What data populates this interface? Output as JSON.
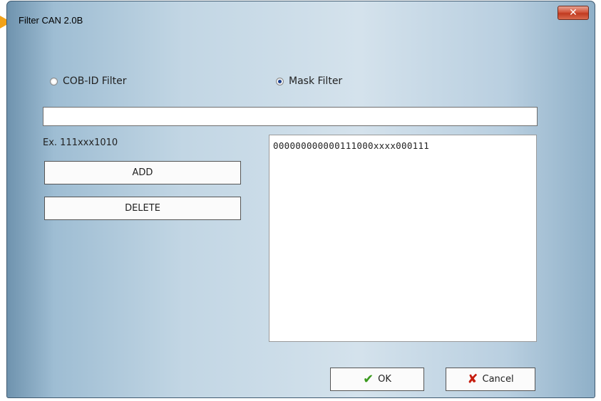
{
  "window": {
    "title": "Filter CAN 2.0B",
    "close_glyph": "✕"
  },
  "filter_mode": {
    "options": [
      {
        "label": "COB-ID Filter",
        "selected": false
      },
      {
        "label": "Mask Filter",
        "selected": true
      }
    ]
  },
  "input": {
    "value": "",
    "hint": "Ex. 111xxx1010"
  },
  "actions": {
    "add_label": "ADD",
    "delete_label": "DELETE"
  },
  "filter_list": {
    "items": [
      "000000000000111000xxxx000111"
    ]
  },
  "footer": {
    "ok_label": "OK",
    "ok_icon": "check-icon",
    "cancel_label": "Cancel",
    "cancel_icon": "cross-icon"
  },
  "colors": {
    "ok_icon": "#3a9a1e",
    "cancel_icon": "#c61e10",
    "radio_selected": "#1a3f8e",
    "marker": "#f2a218"
  }
}
